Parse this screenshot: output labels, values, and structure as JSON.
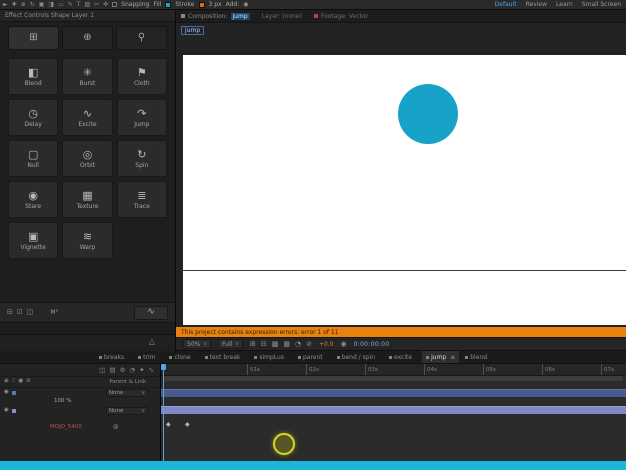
{
  "colors": {
    "accent": "#4ba3e3",
    "teal_circle": "#17a3c7",
    "warning_orange": "#e8820f",
    "layer_bar_1": "#4a5a90",
    "layer_bar_2": "#7e88c4",
    "bottom_strip": "#1db5d8"
  },
  "top_toolbar": {
    "tools": [
      {
        "name": "selection-tool",
        "glyph": "►"
      },
      {
        "name": "hand-tool",
        "glyph": "✚"
      },
      {
        "name": "zoom-tool",
        "glyph": "⊕"
      },
      {
        "name": "rotate-tool",
        "glyph": "↻"
      },
      {
        "name": "camera-tool",
        "glyph": "▣"
      },
      {
        "name": "pan-behind-tool",
        "glyph": "◨"
      },
      {
        "name": "shape-tool",
        "glyph": "▭"
      },
      {
        "name": "pen-tool",
        "glyph": "✎"
      },
      {
        "name": "type-tool",
        "glyph": "T"
      },
      {
        "name": "brush-tool",
        "glyph": "▨"
      },
      {
        "name": "clone-stamp-tool",
        "glyph": "✂"
      },
      {
        "name": "puppet-tool",
        "glyph": "✜"
      }
    ],
    "snapping_label": "Snapping",
    "fill_label": "Fill",
    "stroke_label": "Stroke",
    "stroke_width": "3 px",
    "add_label": "Add:",
    "add_glyph": "◉",
    "workspaces": [
      {
        "label": "Default",
        "active": true
      },
      {
        "label": "Review"
      },
      {
        "label": "Learn"
      },
      {
        "label": "Small Screen"
      }
    ]
  },
  "effects_panel": {
    "header": "Effect Controls Shape Layer 1",
    "view_tabs": [
      {
        "name": "grid-view",
        "glyph": "⊞",
        "active": true
      },
      {
        "name": "motion-view",
        "glyph": "⊕"
      },
      {
        "name": "search-view",
        "glyph": "⚲"
      }
    ],
    "effects": [
      {
        "label": "Blend",
        "glyph": "◧"
      },
      {
        "label": "Burst",
        "glyph": "✳"
      },
      {
        "label": "Cloth",
        "glyph": "⚑"
      },
      {
        "label": "Delay",
        "glyph": "◷"
      },
      {
        "label": "Excite",
        "glyph": "∿"
      },
      {
        "label": "Jump",
        "glyph": "↷"
      },
      {
        "label": "Null",
        "glyph": "▢"
      },
      {
        "label": "Orbit",
        "glyph": "◎"
      },
      {
        "label": "Spin",
        "glyph": "↻"
      },
      {
        "label": "Stare",
        "glyph": "◉"
      },
      {
        "label": "Texture",
        "glyph": "▦"
      },
      {
        "label": "Trace",
        "glyph": "≣"
      },
      {
        "label": "Vignette",
        "glyph": "▣"
      },
      {
        "label": "Warp",
        "glyph": "≋"
      }
    ],
    "footer_icons": [
      {
        "glyph": "⊟"
      },
      {
        "glyph": "⊡"
      },
      {
        "glyph": "◫"
      }
    ],
    "footer_label": "M°",
    "wave_glyph": "∿",
    "triangle_glyph": "△"
  },
  "viewer": {
    "composition_tab_prefix": "Composition:",
    "composition_name": "jump",
    "layer_tab": "Layer: (none)",
    "footage_tab": "Footage: Vector",
    "comp_chip": "jump"
  },
  "warning_bar": {
    "text": "This project contains expression errors: error 1 of 11"
  },
  "viewer_toolbar": {
    "zoom": "50%",
    "resolution": "Full",
    "dropdown_glyph": "∨",
    "icons": [
      {
        "glyph": "⊞"
      },
      {
        "glyph": "⊟"
      },
      {
        "glyph": "▩"
      },
      {
        "glyph": "▦"
      },
      {
        "glyph": "◔"
      },
      {
        "glyph": "⊘"
      }
    ],
    "exposure": "+0.0",
    "camera_glyph": "◉",
    "timecode": "0:00:00:00"
  },
  "timeline": {
    "tabs": [
      {
        "label": "breaks"
      },
      {
        "label": "trim"
      },
      {
        "label": "clone"
      },
      {
        "label": "text break"
      },
      {
        "label": "simpLus"
      },
      {
        "label": "parent"
      },
      {
        "label": "bend / spin"
      },
      {
        "label": "excite"
      },
      {
        "label": "jump",
        "active": true,
        "menu": "≡"
      },
      {
        "label": "blend"
      }
    ],
    "left_toolbar_icons": [
      {
        "glyph": "◫"
      },
      {
        "glyph": "▤"
      },
      {
        "glyph": "⚙"
      },
      {
        "glyph": "◔"
      },
      {
        "glyph": "✦"
      },
      {
        "glyph": "∿"
      }
    ],
    "column_icons": [
      {
        "glyph": "◉"
      },
      {
        "glyph": "♪"
      },
      {
        "glyph": "●"
      },
      {
        "glyph": "⊠"
      }
    ],
    "parent_link_label": "Parent & Link",
    "eye_glyph": "◉",
    "dropdown_glyph": "∨",
    "row1": {
      "none_label": "None"
    },
    "row2": {
      "value": "100 %"
    },
    "row3": {
      "none_label": "None"
    },
    "row4": {
      "name": "MOJO_5400",
      "expression_glyph": "@"
    },
    "ruler": [
      "01s",
      "02s",
      "03s",
      "04s",
      "05s",
      "06s",
      "07s"
    ],
    "keyframes": [
      "◆",
      "◆"
    ]
  }
}
